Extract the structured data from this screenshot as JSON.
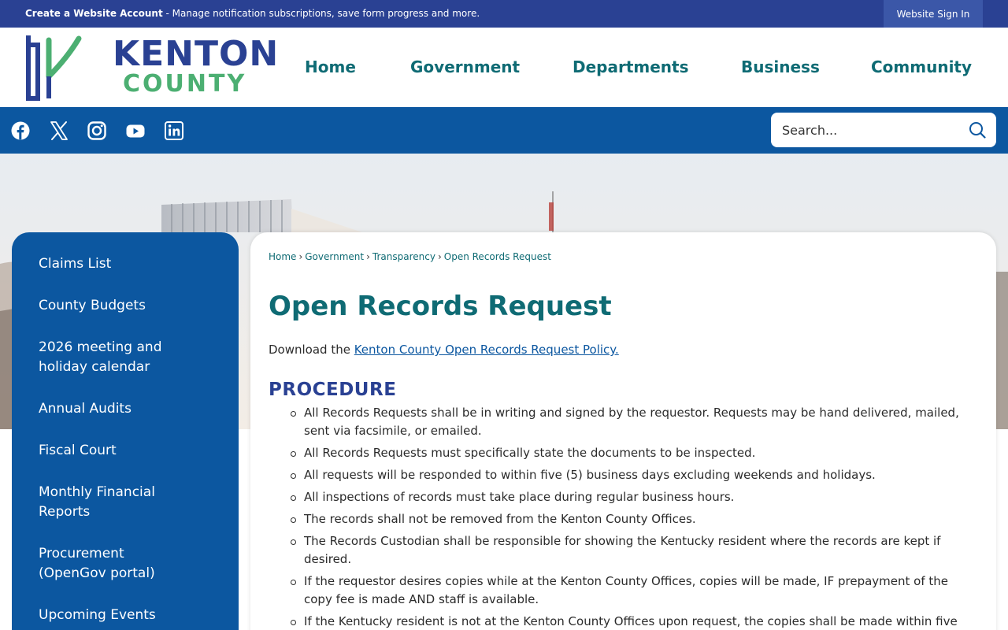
{
  "topbar": {
    "account_link": "Create a Website Account",
    "account_desc": " - Manage notification subscriptions, save form progress and more.",
    "signin": "Website Sign In"
  },
  "logo": {
    "line1": "KENTON",
    "line2": "COUNTY"
  },
  "nav": [
    "Home",
    "Government",
    "Departments",
    "Business",
    "Community"
  ],
  "social": [
    "facebook-icon",
    "x-icon",
    "instagram-icon",
    "youtube-icon",
    "linkedin-icon"
  ],
  "search": {
    "placeholder": "Search..."
  },
  "sidebar": {
    "items": [
      "Claims List",
      "County Budgets",
      "2026 meeting and holiday calendar",
      "Annual Audits",
      "Fiscal Court",
      "Monthly Financial Reports",
      "Procurement (OpenGov portal)",
      "Upcoming Events"
    ]
  },
  "breadcrumb": [
    "Home",
    "Government",
    "Transparency",
    "Open Records Request"
  ],
  "page": {
    "title": "Open Records Request",
    "intro_prefix": "Download the ",
    "intro_link": "Kenton County Open Records Request Policy.",
    "procedure_heading": "PROCEDURE",
    "procedure": [
      "All Records Requests shall be in writing and signed by the requestor. Requests may be hand delivered, mailed, sent via facsimile, or emailed.",
      "All Records Requests must specifically state the documents to be inspected.",
      " All requests will be responded to within five (5) business days excluding weekends and holidays.",
      "All inspections of records must take place during regular business hours.",
      "The records shall not be removed from the Kenton County Offices.",
      "The Records Custodian shall be responsible for showing the Kentucky resident where the records are kept if desired.",
      "If the requestor desires copies while at the Kenton County Offices, copies will be made, IF prepayment of the copy fee is made AND staff is available.",
      "If the Kentucky resident is not at the Kenton County Offices upon request, the copies shall be made within five"
    ]
  },
  "colors": {
    "topbar": "#2a4193",
    "social_bar": "#0c57a0",
    "nav_text": "#0f6b74",
    "heading": "#0f6b74",
    "procedure": "#2a4193",
    "logo_green": "#4caf72"
  }
}
